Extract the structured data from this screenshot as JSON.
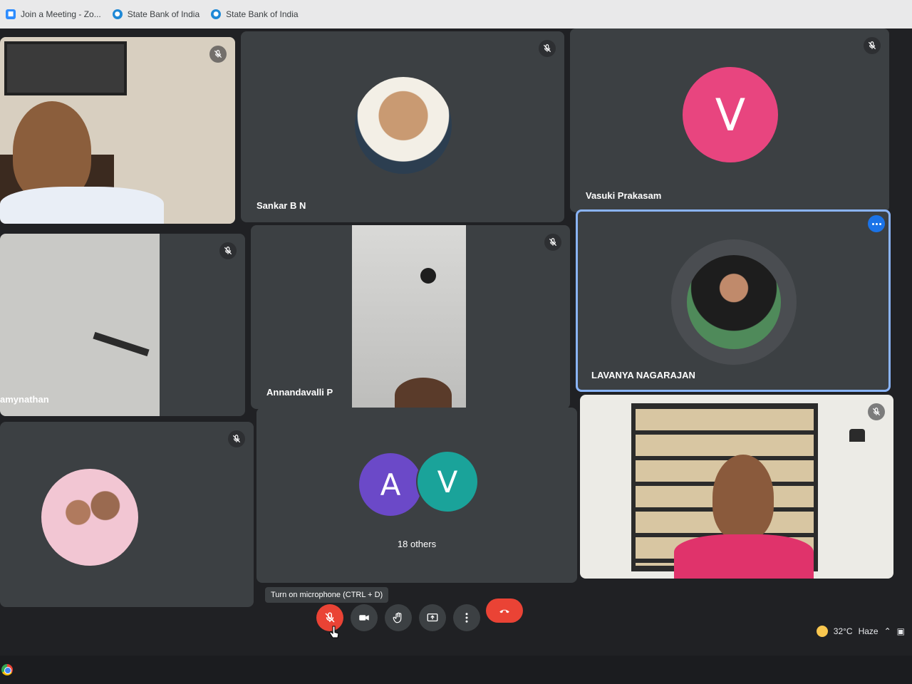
{
  "bookmarks": [
    {
      "label": "Join a Meeting - Zo...",
      "icon": "zoom-icon"
    },
    {
      "label": "State Bank of India",
      "icon": "sbi-icon"
    },
    {
      "label": "State Bank of India",
      "icon": "sbi-icon"
    }
  ],
  "participants": {
    "p1": {
      "name": ""
    },
    "p2": {
      "name": "Sankar B N",
      "avatar_type": "photo"
    },
    "p3": {
      "name": "Vasuki Prakasam",
      "avatar_letter": "V",
      "avatar_color": "#e8457f"
    },
    "p4": {
      "name": "amynathan"
    },
    "p5": {
      "name": "Annandavalli P"
    },
    "p6": {
      "name": "LAVANYA NAGARAJAN",
      "speaking": true
    },
    "p7": {
      "name": ""
    },
    "p8": {
      "letters": [
        "A",
        "V"
      ],
      "colors": [
        "#6b49c8",
        "#1aa39a"
      ],
      "label": "18 others"
    },
    "p9": {
      "name": ""
    }
  },
  "controls": {
    "tooltip": "Turn on microphone (CTRL + D)",
    "buttons": [
      "mic-off-button",
      "camera-button",
      "raise-hand-button",
      "present-button",
      "more-options-button",
      "leave-call-button"
    ]
  },
  "tray": {
    "temperature": "32°C",
    "weather": "Haze"
  },
  "colors": {
    "tile_bg": "#3c4043",
    "stage_bg": "#202124",
    "accent": "#8ab4f8",
    "danger": "#ea4335"
  }
}
